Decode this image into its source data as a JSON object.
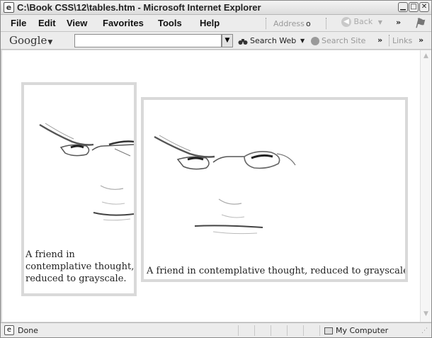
{
  "window": {
    "title": "C:\\Book CSS\\12\\tables.htm - Microsoft Internet Explorer",
    "icon": "ie-page-icon"
  },
  "menu": {
    "items": [
      "File",
      "Edit",
      "View",
      "Favorites",
      "Tools",
      "Help"
    ],
    "address_label": "Address",
    "address_value": "o",
    "back_label": "Back"
  },
  "google_toolbar": {
    "logo": "Google",
    "search_value": "",
    "search_web_label": "Search Web",
    "search_site_label": "Search Site",
    "links_label": "Links"
  },
  "page": {
    "left_caption": "A friend in contemplative thought, reduced to grayscale.",
    "right_caption": "A friend in contemplative thought, reduced to grayscale."
  },
  "status": {
    "text": "Done",
    "zone": "My Computer"
  },
  "colors": {
    "frame_border": "#d9d9d9",
    "chrome": "#ececec"
  }
}
